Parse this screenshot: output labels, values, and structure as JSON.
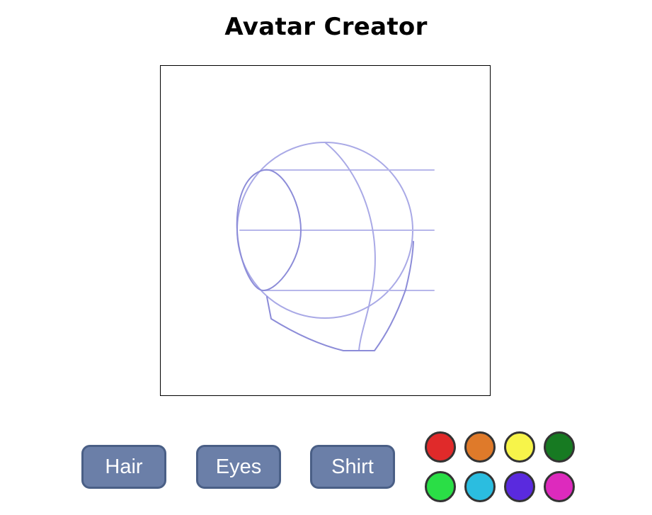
{
  "title": "Avatar Creator",
  "buttons": {
    "hair": "Hair",
    "eyes": "Eyes",
    "shirt": "Shirt"
  },
  "palette": [
    {
      "name": "red",
      "color": "#e02a2a"
    },
    {
      "name": "orange",
      "color": "#df7a2a"
    },
    {
      "name": "yellow",
      "color": "#f7f44a"
    },
    {
      "name": "dark-green",
      "color": "#177a22"
    },
    {
      "name": "green",
      "color": "#2ade46"
    },
    {
      "name": "cyan",
      "color": "#2bbde0"
    },
    {
      "name": "purple",
      "color": "#5a2ade"
    },
    {
      "name": "magenta",
      "color": "#dd2abd"
    }
  ],
  "colors": {
    "button_fill": "#6b7fa8",
    "button_border": "#4a5f86",
    "sketch_stroke": "#8f8fdc"
  }
}
